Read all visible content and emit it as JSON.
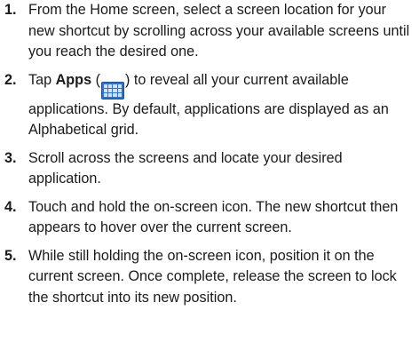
{
  "steps": [
    {
      "number": "1.",
      "text": "From the Home screen, select a screen location for your new shortcut by scrolling across your available screens until you reach the desired one."
    },
    {
      "number": "2.",
      "before": "Tap ",
      "bold": "Apps",
      "paren_open": " (",
      "icon": "apps-grid-icon",
      "after": ") to reveal all your current available applications. By default, applications are displayed as an Alphabetical grid."
    },
    {
      "number": "3.",
      "text": "Scroll across the screens and locate your desired application."
    },
    {
      "number": "4.",
      "text": "Touch and hold the on-screen icon. The new shortcut then appears to hover over the current screen."
    },
    {
      "number": "5.",
      "text": "While still holding the on-screen icon, position it on the current screen. Once complete, release the screen to lock the shortcut into its new position."
    }
  ],
  "colors": {
    "text": "#1a1a1a",
    "icon_fill": "#2f73c4",
    "icon_cells": "#cfe1f7"
  }
}
